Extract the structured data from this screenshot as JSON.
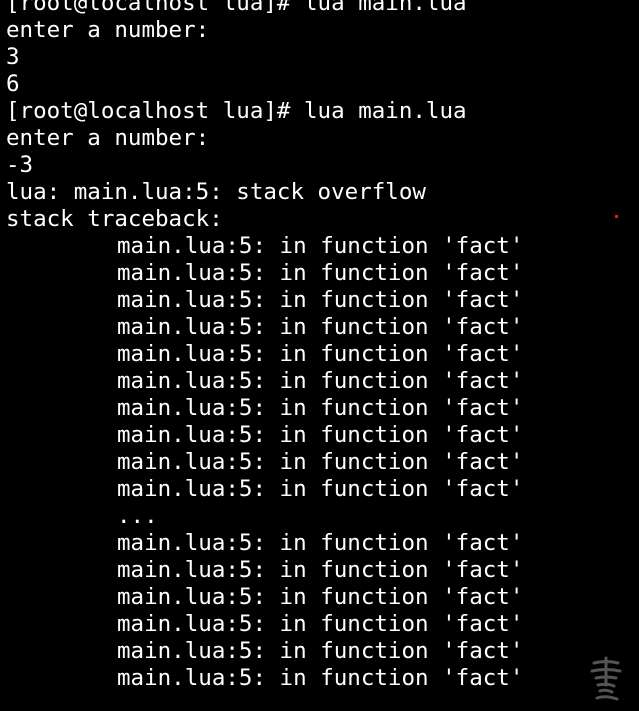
{
  "terminal": {
    "lines": [
      {
        "text": "[root@localhost lua]# lua main.lua",
        "indent": false
      },
      {
        "text": "enter a number:",
        "indent": false
      },
      {
        "text": "3",
        "indent": false
      },
      {
        "text": "6",
        "indent": false
      },
      {
        "text": "[root@localhost lua]# lua main.lua",
        "indent": false
      },
      {
        "text": "enter a number:",
        "indent": false
      },
      {
        "text": "-3",
        "indent": false
      },
      {
        "text": "lua: main.lua:5: stack overflow",
        "indent": false
      },
      {
        "text": "stack traceback:",
        "indent": false
      },
      {
        "text": "main.lua:5: in function 'fact'",
        "indent": true
      },
      {
        "text": "main.lua:5: in function 'fact'",
        "indent": true
      },
      {
        "text": "main.lua:5: in function 'fact'",
        "indent": true
      },
      {
        "text": "main.lua:5: in function 'fact'",
        "indent": true
      },
      {
        "text": "main.lua:5: in function 'fact'",
        "indent": true
      },
      {
        "text": "main.lua:5: in function 'fact'",
        "indent": true
      },
      {
        "text": "main.lua:5: in function 'fact'",
        "indent": true
      },
      {
        "text": "main.lua:5: in function 'fact'",
        "indent": true
      },
      {
        "text": "main.lua:5: in function 'fact'",
        "indent": true
      },
      {
        "text": "main.lua:5: in function 'fact'",
        "indent": true
      },
      {
        "text": "...",
        "indent": true
      },
      {
        "text": "main.lua:5: in function 'fact'",
        "indent": true
      },
      {
        "text": "main.lua:5: in function 'fact'",
        "indent": true
      },
      {
        "text": "main.lua:5: in function 'fact'",
        "indent": true
      },
      {
        "text": "main.lua:5: in function 'fact'",
        "indent": true
      },
      {
        "text": "main.lua:5: in function 'fact'",
        "indent": true
      },
      {
        "text": "main.lua:5: in function 'fact'",
        "indent": true
      }
    ]
  },
  "colors": {
    "background": "#000000",
    "foreground": "#ffffff",
    "red_dot": "#e01b1b"
  },
  "icons": {
    "watermark": "calligraphy-watermark-icon"
  }
}
